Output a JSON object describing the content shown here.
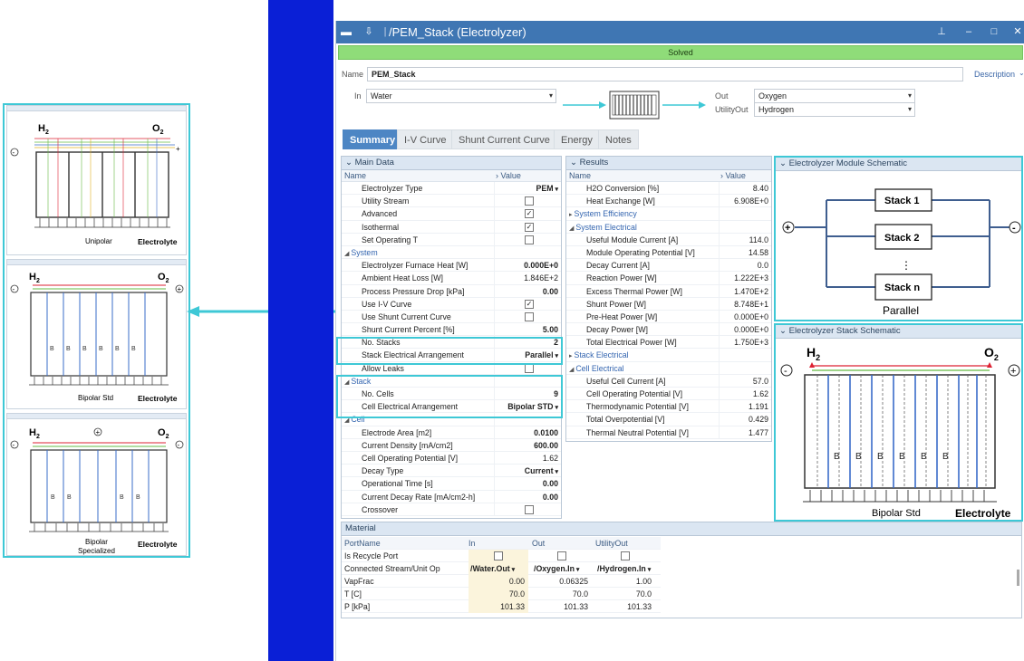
{
  "window": {
    "title": "/PEM_Stack (Electrolyzer)",
    "status": "Solved"
  },
  "header": {
    "name_label": "Name",
    "name_value": "PEM_Stack",
    "description_label": "Description",
    "in_label": "In",
    "in_value": "Water",
    "out_label": "Out",
    "out_value": "Oxygen",
    "utilityout_label": "UtilityOut",
    "utilityout_value": "Hydrogen"
  },
  "tabs": [
    "Summary",
    "I-V Curve",
    "Shunt Current Curve",
    "Energy",
    "Notes"
  ],
  "main_data": {
    "title": "Main Data",
    "col_name": "Name",
    "col_value": "Value",
    "rows": [
      {
        "label": "Electrolyzer Type",
        "value": "PEM",
        "kind": "combo"
      },
      {
        "label": "Utility Stream",
        "value": "",
        "kind": "check",
        "checked": false
      },
      {
        "label": "Advanced",
        "value": "",
        "kind": "check",
        "checked": true
      },
      {
        "label": "Isothermal",
        "value": "",
        "kind": "check",
        "checked": true
      },
      {
        "label": "Set Operating T",
        "value": "",
        "kind": "check",
        "checked": false
      },
      {
        "label": "System",
        "value": "",
        "kind": "section"
      },
      {
        "label": "Electrolyzer Furnace Heat [W]",
        "value": "0.000E+0",
        "kind": "bold"
      },
      {
        "label": "Ambient Heat Loss [W]",
        "value": "1.846E+2",
        "kind": "plain"
      },
      {
        "label": "Process Pressure Drop [kPa]",
        "value": "0.00",
        "kind": "bold"
      },
      {
        "label": "Use I-V Curve",
        "value": "",
        "kind": "check",
        "checked": true
      },
      {
        "label": "Use Shunt Current Curve",
        "value": "",
        "kind": "check",
        "checked": false
      },
      {
        "label": "Shunt Current Percent [%]",
        "value": "5.00",
        "kind": "bold"
      },
      {
        "label": "No. Stacks",
        "value": "2",
        "kind": "bold"
      },
      {
        "label": "Stack Electrical Arrangement",
        "value": "Parallel",
        "kind": "combo"
      },
      {
        "label": "Allow Leaks",
        "value": "",
        "kind": "check",
        "checked": false
      },
      {
        "label": "Stack",
        "value": "",
        "kind": "section"
      },
      {
        "label": "No. Cells",
        "value": "9",
        "kind": "bold"
      },
      {
        "label": "Cell Electrical Arrangement",
        "value": "Bipolar STD",
        "kind": "combo"
      },
      {
        "label": "Cell",
        "value": "",
        "kind": "section"
      },
      {
        "label": "Electrode Area [m2]",
        "value": "0.0100",
        "kind": "bold"
      },
      {
        "label": "Current Density [mA/cm2]",
        "value": "600.00",
        "kind": "bold"
      },
      {
        "label": "Cell Operating Potential [V]",
        "value": "1.62",
        "kind": "plain"
      },
      {
        "label": "Decay Type",
        "value": "Current",
        "kind": "combo"
      },
      {
        "label": "Operational Time [s]",
        "value": "0.00",
        "kind": "bold"
      },
      {
        "label": "Current Decay Rate [mA/cm2-h]",
        "value": "0.00",
        "kind": "bold"
      },
      {
        "label": "Crossover",
        "value": "",
        "kind": "check",
        "checked": false
      }
    ]
  },
  "results": {
    "title": "Results",
    "col_name": "Name",
    "col_value": "Value",
    "rows": [
      {
        "label": "H2O Conversion [%]",
        "value": "8.40",
        "kind": "plain"
      },
      {
        "label": "Heat Exchange [W]",
        "value": "6.908E+0",
        "kind": "plain"
      },
      {
        "label": "System Efficiency",
        "value": "",
        "kind": "collapsed"
      },
      {
        "label": "System Electrical",
        "value": "",
        "kind": "section"
      },
      {
        "label": "Useful Module Current [A]",
        "value": "114.0",
        "kind": "plain"
      },
      {
        "label": "Module Operating Potential [V]",
        "value": "14.58",
        "kind": "plain"
      },
      {
        "label": "Decay Current [A]",
        "value": "0.0",
        "kind": "plain"
      },
      {
        "label": "Reaction Power [W]",
        "value": "1.222E+3",
        "kind": "plain"
      },
      {
        "label": "Excess Thermal Power [W]",
        "value": "1.470E+2",
        "kind": "plain"
      },
      {
        "label": "Shunt Power [W]",
        "value": "8.748E+1",
        "kind": "plain"
      },
      {
        "label": "Pre-Heat Power [W]",
        "value": "0.000E+0",
        "kind": "plain"
      },
      {
        "label": "Decay Power [W]",
        "value": "0.000E+0",
        "kind": "plain"
      },
      {
        "label": "Total Electrical Power [W]",
        "value": "1.750E+3",
        "kind": "plain"
      },
      {
        "label": "Stack Electrical",
        "value": "",
        "kind": "collapsed"
      },
      {
        "label": "Cell Electrical",
        "value": "",
        "kind": "section"
      },
      {
        "label": "Useful Cell Current [A]",
        "value": "57.0",
        "kind": "plain"
      },
      {
        "label": "Cell Operating Potential [V]",
        "value": "1.62",
        "kind": "plain"
      },
      {
        "label": "Thermodynamic Potential [V]",
        "value": "1.191",
        "kind": "plain"
      },
      {
        "label": "Total Overpotential [V]",
        "value": "0.429",
        "kind": "plain"
      },
      {
        "label": "Thermal Neutral Potential [V]",
        "value": "1.477",
        "kind": "plain"
      }
    ]
  },
  "module_schematic": {
    "title": "Electrolyzer Module Schematic",
    "stack1": "Stack 1",
    "stack2": "Stack 2",
    "stackn": "Stack n",
    "caption": "Parallel",
    "plus": "+",
    "minus": "-",
    "dots": "⋮"
  },
  "stack_schematic": {
    "title": "Electrolyzer Stack Schematic",
    "h2": "H",
    "h2_sub": "2",
    "o2": "O",
    "o2_sub": "2",
    "b_label": "B",
    "caption": "Bipolar Std",
    "electrolyte": "Electrolyte"
  },
  "left_schematics": {
    "h2": "H",
    "o2": "O",
    "sub": "2",
    "unipolar": "Unipolar",
    "bipolar_std": "Bipolar Std",
    "bipolar_spec_1": "Bipolar",
    "bipolar_spec_2": "Specialized",
    "electrolyte": "Electrolyte",
    "b_label": "B"
  },
  "material": {
    "title": "Material",
    "headers": [
      "PortName",
      "In",
      "Out",
      "UtilityOut"
    ],
    "rows": [
      {
        "label": "Is Recycle Port",
        "kind": "check",
        "values": [
          "",
          "",
          ""
        ]
      },
      {
        "label": "Connected Stream/Unit Op",
        "kind": "combo",
        "values": [
          "/Water.Out",
          "/Oxygen.In",
          "/Hydrogen.In"
        ]
      },
      {
        "label": "VapFrac",
        "kind": "plain",
        "values": [
          "0.00",
          "0.06325",
          "1.00"
        ]
      },
      {
        "label": "T [C]",
        "kind": "plain",
        "values": [
          "70.0",
          "70.0",
          "70.0"
        ]
      },
      {
        "label": "P [kPa]",
        "kind": "plain",
        "values": [
          "101.33",
          "101.33",
          "101.33"
        ]
      }
    ]
  },
  "colors": {
    "accent": "#3ec8d6",
    "titlebar": "#3f76b3",
    "solved": "#8fdc79",
    "blue_bar": "#0a1fd6"
  }
}
